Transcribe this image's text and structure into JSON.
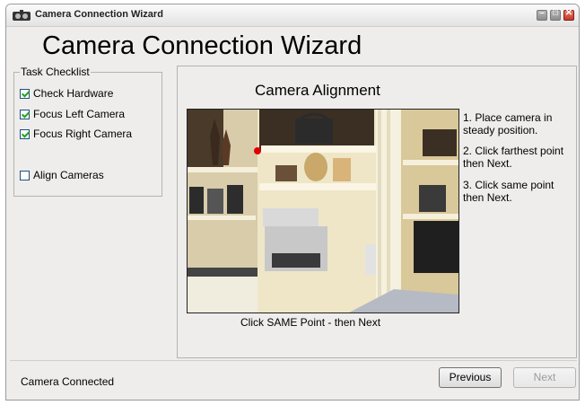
{
  "window": {
    "title": "Camera Connection Wizard",
    "min_glyph": "–",
    "max_glyph": "□",
    "close_glyph": "✕"
  },
  "heading": "Camera Connection Wizard",
  "checklist": {
    "legend": "Task Checklist",
    "items": [
      {
        "label": "Check Hardware",
        "checked": true
      },
      {
        "label": "Focus Left Camera",
        "checked": true
      },
      {
        "label": "Focus Right Camera",
        "checked": true
      },
      {
        "label": "Align Cameras",
        "checked": false
      }
    ]
  },
  "panel": {
    "title": "Camera Alignment",
    "caption": "Click SAME Point - then Next",
    "instructions": [
      "1. Place camera in steady position.",
      "2. Click farthest point then Next.",
      "3. Click same point then Next."
    ]
  },
  "status": "Camera Connected",
  "buttons": {
    "previous": "Previous",
    "next": "Next",
    "next_enabled": false
  },
  "colors": {
    "check_mark": "#21a121",
    "marker": "#e00000",
    "close_button": "#c0392b"
  }
}
